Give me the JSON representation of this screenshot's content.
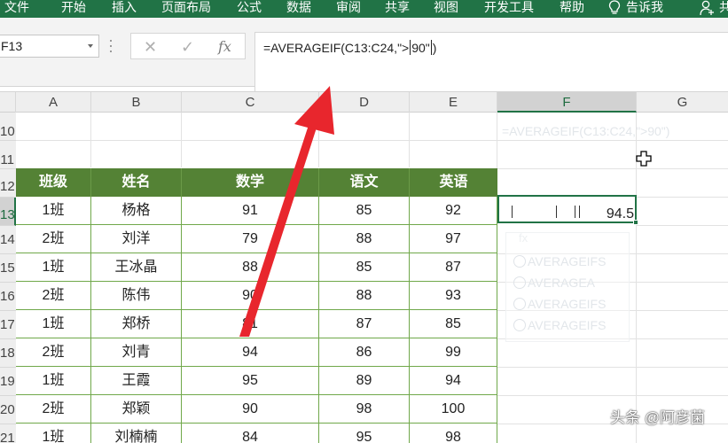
{
  "ribbon": {
    "tabs": [
      "文件",
      "开始",
      "插入",
      "页面布局",
      "公式",
      "数据",
      "审阅",
      "共享",
      "视图",
      "开发工具",
      "帮助"
    ],
    "tell_me": "告诉我",
    "share_partial": "共"
  },
  "formula_bar": {
    "name_box": "F13",
    "formula_before_caret": "=AVERAGEIF(C13:C24,\">",
    "formula_after_caret": "90\"",
    "cancel_glyph": "✕",
    "enter_glyph": "✓",
    "fx_label": "fx"
  },
  "columns": [
    "A",
    "B",
    "C",
    "D",
    "E",
    "F",
    "G"
  ],
  "rows": [
    "10",
    "11",
    "12",
    "13",
    "14",
    "15",
    "16",
    "17",
    "18",
    "19",
    "20",
    "21"
  ],
  "table": {
    "headers": [
      "班级",
      "姓名",
      "数学",
      "语文",
      "英语"
    ],
    "rows": [
      [
        "1班",
        "杨格",
        "91",
        "85",
        "92"
      ],
      [
        "2班",
        "刘洋",
        "79",
        "88",
        "97"
      ],
      [
        "1班",
        "王冰晶",
        "88",
        "85",
        "87"
      ],
      [
        "2班",
        "陈伟",
        "90",
        "88",
        "93"
      ],
      [
        "1班",
        "郑桥",
        "81",
        "87",
        "85"
      ],
      [
        "2班",
        "刘青",
        "94",
        "86",
        "99"
      ],
      [
        "1班",
        "王霞",
        "95",
        "89",
        "94"
      ],
      [
        "2班",
        "郑颖",
        "90",
        "98",
        "100"
      ],
      [
        "1班",
        "刘楠楠",
        "84",
        "95",
        "98"
      ]
    ]
  },
  "result_cell": "94.5",
  "ghost": {
    "formula": "=AVERAGEIF(C13:C24,\">90\")",
    "hint": "fx",
    "items": [
      "AVERAGEIFS",
      "AVERAGEA",
      "AVERAGEIFS",
      "AVERAGEIFS"
    ]
  },
  "watermark": "头条 @阿彦菌",
  "colors": {
    "ribbon": "#217346",
    "table_header": "#548235",
    "table_border": "#70a84a",
    "arrow": "#e8262d"
  },
  "icons": {
    "tell_me": "lightbulb-icon",
    "account": "person-icon",
    "cursor": "cross-cursor-icon"
  }
}
